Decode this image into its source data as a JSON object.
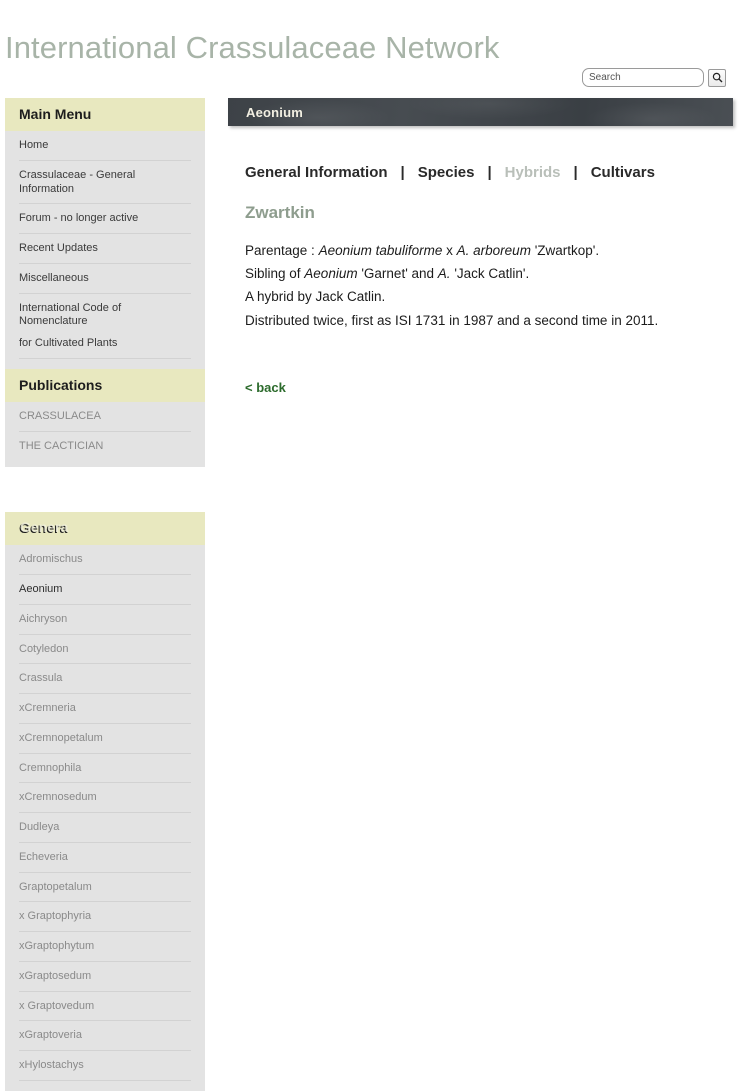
{
  "site": {
    "title": "International Crassulaceae Network"
  },
  "search": {
    "placeholder": "Search",
    "value": "",
    "icon": "search-icon",
    "button_label": ""
  },
  "sidebar": {
    "panels": [
      {
        "id": "main-menu",
        "heading": "Main Menu",
        "items": [
          {
            "label": "Home",
            "style": "normal"
          },
          {
            "label": "Crassulaceae - General Information",
            "style": "normal"
          },
          {
            "label": "Forum - no longer active",
            "style": "normal"
          },
          {
            "label": "Recent Updates",
            "style": "normal"
          },
          {
            "label": "Miscellaneous",
            "style": "normal"
          },
          {
            "label": "International Code of Nomenclature",
            "style": "wrap-first"
          },
          {
            "label": "for Cultivated Plants",
            "style": "wrap-second"
          }
        ]
      },
      {
        "id": "publications",
        "heading": "Publications",
        "items": [
          {
            "label": "CRASSULACEA",
            "style": "muted"
          },
          {
            "label": "THE CACTICIAN",
            "style": "muted"
          }
        ]
      },
      {
        "id": "genera",
        "heading": "Genera",
        "items": [
          {
            "label": "Adromischus",
            "style": "muted"
          },
          {
            "label": "Aeonium",
            "style": "active"
          },
          {
            "label": "Aichryson",
            "style": "muted"
          },
          {
            "label": "Cotyledon",
            "style": "muted"
          },
          {
            "label": "Crassula",
            "style": "muted"
          },
          {
            "label": "xCremneria",
            "style": "muted"
          },
          {
            "label": "xCremnopetalum",
            "style": "muted"
          },
          {
            "label": "Cremnophila",
            "style": "muted"
          },
          {
            "label": "xCremnosedum",
            "style": "muted"
          },
          {
            "label": "Dudleya",
            "style": "muted"
          },
          {
            "label": "Echeveria",
            "style": "muted"
          },
          {
            "label": "Graptopetalum",
            "style": "muted"
          },
          {
            "label": "x Graptophyria",
            "style": "muted"
          },
          {
            "label": "xGraptophytum",
            "style": "muted"
          },
          {
            "label": "xGraptosedum",
            "style": "muted"
          },
          {
            "label": "x Graptovedum",
            "style": "muted"
          },
          {
            "label": "xGraptoveria",
            "style": "muted"
          },
          {
            "label": "xHylostachys",
            "style": "muted"
          }
        ]
      }
    ]
  },
  "main": {
    "banner_title": "Aeonium",
    "tabs": [
      {
        "label": "General Information",
        "current": false
      },
      {
        "label": "Species",
        "current": false
      },
      {
        "label": "Hybrids",
        "current": true
      },
      {
        "label": "Cultivars",
        "current": false
      }
    ],
    "tab_separator": "|",
    "cultivar_name": "Zwartkin",
    "lines": [
      {
        "parts": [
          {
            "text": "Parentage : ",
            "italic": false
          },
          {
            "text": "Aeonium tabuliforme",
            "italic": true
          },
          {
            "text": " x ",
            "italic": false
          },
          {
            "text": "A. arboreum",
            "italic": true
          },
          {
            "text": " 'Zwartkop'.",
            "italic": false
          }
        ]
      },
      {
        "parts": [
          {
            "text": "Sibling of ",
            "italic": false
          },
          {
            "text": "Aeonium",
            "italic": true
          },
          {
            "text": " 'Garnet' and ",
            "italic": false
          },
          {
            "text": "A.",
            "italic": true
          },
          {
            "text": " 'Jack Catlin'.",
            "italic": false
          }
        ]
      },
      {
        "parts": [
          {
            "text": "A hybrid by Jack Catlin.",
            "italic": false
          }
        ]
      },
      {
        "parts": [
          {
            "text": "Distributed twice, first as ISI 1731 in 1987 and a second time in 2011.",
            "italic": false
          }
        ]
      }
    ],
    "back_label": "< back"
  },
  "colors": {
    "panel_heading_bg": "#e8e8bf",
    "panel_bg": "#e3e3e3",
    "site_title": "#a8b4a8",
    "cultivar_name": "#8e9d8e",
    "tab_current": "#b9bfb9",
    "back_link": "#2c6b2c",
    "banner_bg": "#434851"
  }
}
